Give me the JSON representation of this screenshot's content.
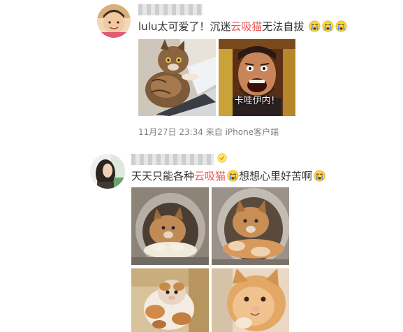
{
  "posts": [
    {
      "text_before": "lulu太可爱了！沉迷",
      "highlight": "云吸猫",
      "text_after": "无法自拔",
      "emoji_icons": [
        "crying-face-icon",
        "crying-face-icon",
        "crying-face-icon"
      ],
      "images": [
        {
          "name": "cat-on-laptop-photo"
        },
        {
          "name": "screaming-man-meme-photo",
          "caption": "卡哇伊内！"
        }
      ],
      "timestamp": "11月27日 23:34 来自 iPhone客户端"
    },
    {
      "text_before": "天天只能各种",
      "highlight": "云吸猫",
      "text_middle": "想想心里好苦啊",
      "emoji_icons": [
        "crying-face-icon",
        "crying-face-icon"
      ],
      "images": [
        {
          "name": "cat-in-bed-photo-1"
        },
        {
          "name": "cat-in-bed-photo-2"
        },
        {
          "name": "scottish-fold-box-photo"
        },
        {
          "name": "ginger-kitten-closeup-photo"
        }
      ]
    }
  ],
  "colors": {
    "highlight": "#eb5757",
    "body_text": "#333333",
    "meta_text": "#808080"
  }
}
